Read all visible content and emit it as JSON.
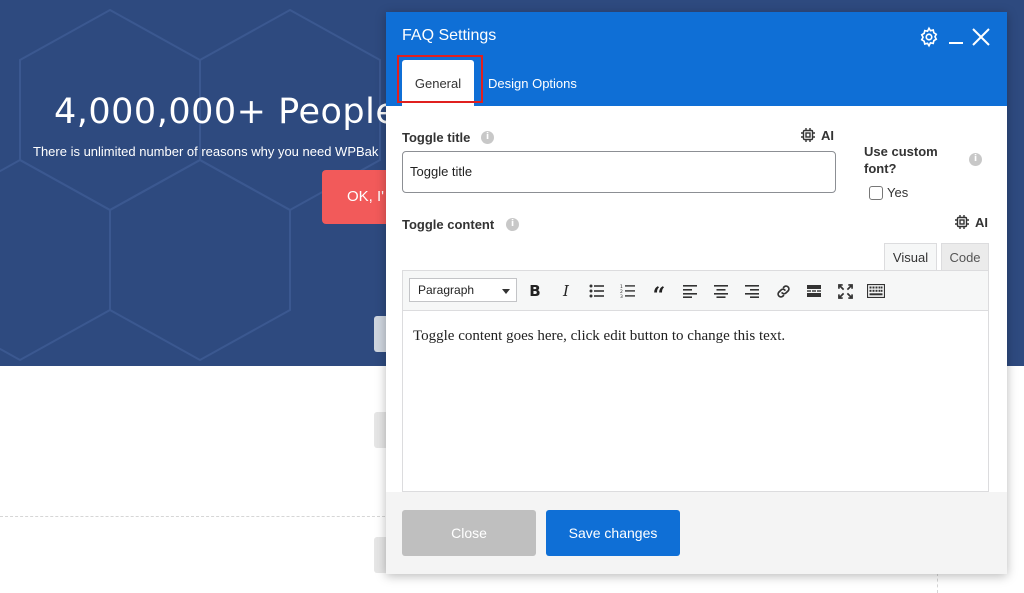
{
  "background": {
    "hero_title": "4,000,000+ People",
    "hero_subtitle": "There is unlimited number of reasons why you need WPBak",
    "hero_button": "OK, I'"
  },
  "dialog": {
    "title": "FAQ Settings",
    "header_icons": [
      "gear-icon",
      "minimize-icon",
      "close-icon"
    ],
    "tabs": [
      {
        "label": "General",
        "active": true
      },
      {
        "label": "Design Options",
        "active": false
      }
    ],
    "toggle_title": {
      "label": "Toggle title",
      "ai_label": "AI",
      "value": "Toggle title"
    },
    "custom_font": {
      "label": "Use custom font?",
      "checkbox_label": "Yes",
      "checked": false
    },
    "toggle_content": {
      "label": "Toggle content",
      "ai_label": "AI",
      "editor_tabs": [
        "Visual",
        "Code"
      ],
      "format_select": "Paragraph",
      "toolbar_icons": [
        "bold-icon",
        "italic-icon",
        "bullet-list-icon",
        "numbered-list-icon",
        "blockquote-icon",
        "align-left-icon",
        "align-center-icon",
        "align-right-icon",
        "link-icon",
        "read-more-icon",
        "fullscreen-icon",
        "toolbar-toggle-icon"
      ],
      "text": "Toggle content goes here, click edit button to change this text."
    },
    "footer": {
      "close_label": "Close",
      "save_label": "Save changes"
    }
  },
  "colors": {
    "header_blue": "#0f6fd6",
    "hero_blue": "#2e4a7f",
    "hero_button": "#f25a5a",
    "highlight_red": "#e0201f"
  }
}
